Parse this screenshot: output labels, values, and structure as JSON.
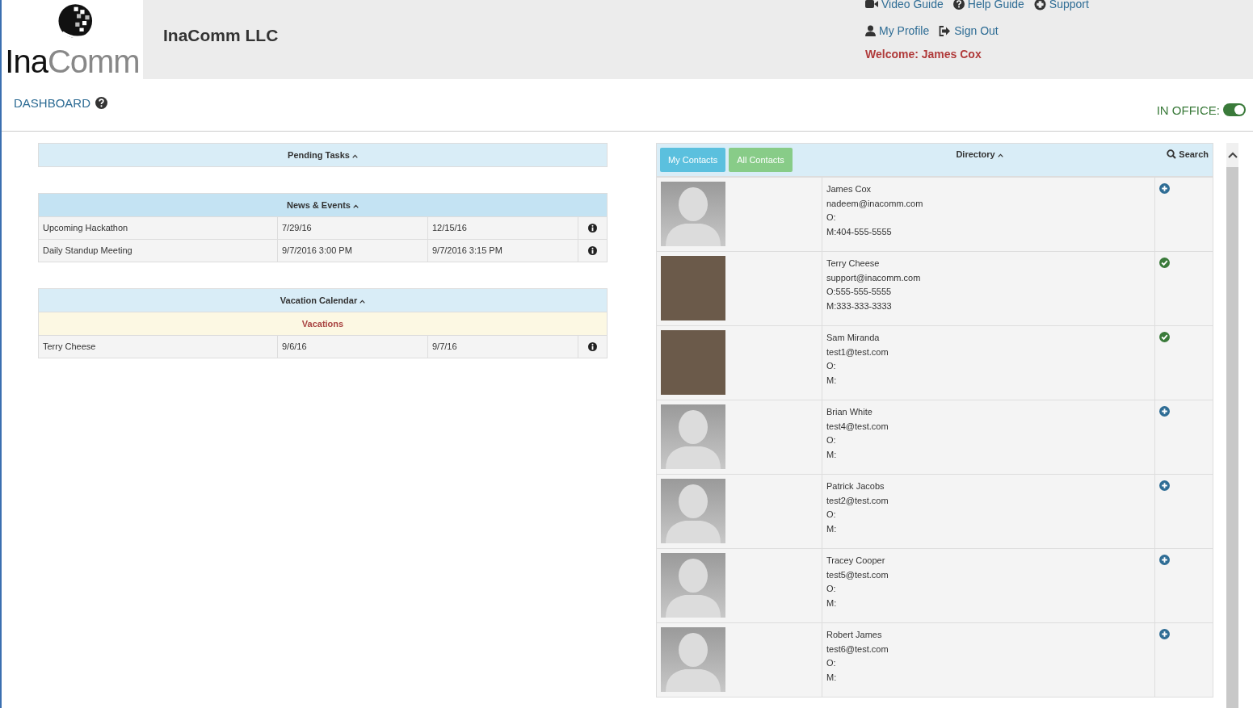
{
  "header": {
    "logo_text": {
      "dark": "Ina",
      "light": "Comm"
    },
    "company": "InaComm LLC",
    "links_top": [
      {
        "kind": "video",
        "label": "Video Guide"
      },
      {
        "kind": "help",
        "label": "Help Guide"
      },
      {
        "kind": "support",
        "label": "Support"
      }
    ],
    "links_user": [
      {
        "kind": "profile",
        "label": "My Profile"
      },
      {
        "kind": "signout",
        "label": "Sign Out"
      }
    ],
    "welcome": "Welcome: James Cox"
  },
  "page": {
    "title": "DASHBOARD",
    "status_label": "IN OFFICE:",
    "in_office": true
  },
  "pending_tasks": {
    "title": "Pending Tasks"
  },
  "news_events": {
    "title": "News & Events",
    "rows": [
      {
        "name": "Upcoming Hackathon",
        "start": "7/29/16",
        "end": "12/15/16"
      },
      {
        "name": "Daily Standup Meeting",
        "start": "9/7/2016 3:00 PM",
        "end": "9/7/2016 3:15 PM"
      }
    ]
  },
  "vacation_calendar": {
    "title": "Vacation Calendar",
    "subheading": "Vacations",
    "rows": [
      {
        "name": "Terry Cheese",
        "start": "9/6/16",
        "end": "9/7/16"
      }
    ]
  },
  "directory": {
    "title": "Directory",
    "tabs": [
      {
        "label": "My Contacts",
        "kind": "mine"
      },
      {
        "label": "All Contacts",
        "kind": "all"
      }
    ],
    "search": "Search",
    "contacts": [
      {
        "has_photo": false,
        "name": "James Cox",
        "email": "nadeem@inacomm.com",
        "office": "O:",
        "mobile": "M:404-555-5555",
        "in_contacts": false
      },
      {
        "has_photo": true,
        "name": "Terry Cheese",
        "email": "support@inacomm.com",
        "office": "O:555-555-5555",
        "mobile": "M:333-333-3333",
        "in_contacts": true
      },
      {
        "has_photo": true,
        "name": "Sam Miranda",
        "email": "test1@test.com",
        "office": "O:",
        "mobile": "M:",
        "in_contacts": true
      },
      {
        "has_photo": false,
        "name": "Brian White",
        "email": "test4@test.com",
        "office": "O:",
        "mobile": "M:",
        "in_contacts": false
      },
      {
        "has_photo": false,
        "name": "Patrick Jacobs",
        "email": "test2@test.com",
        "office": "O:",
        "mobile": "M:",
        "in_contacts": false
      },
      {
        "has_photo": false,
        "name": "Tracey Cooper",
        "email": "test5@test.com",
        "office": "O:",
        "mobile": "M:",
        "in_contacts": false
      },
      {
        "has_photo": false,
        "name": "Robert James",
        "email": "test6@test.com",
        "office": "O:",
        "mobile": "M:",
        "in_contacts": false
      }
    ]
  }
}
